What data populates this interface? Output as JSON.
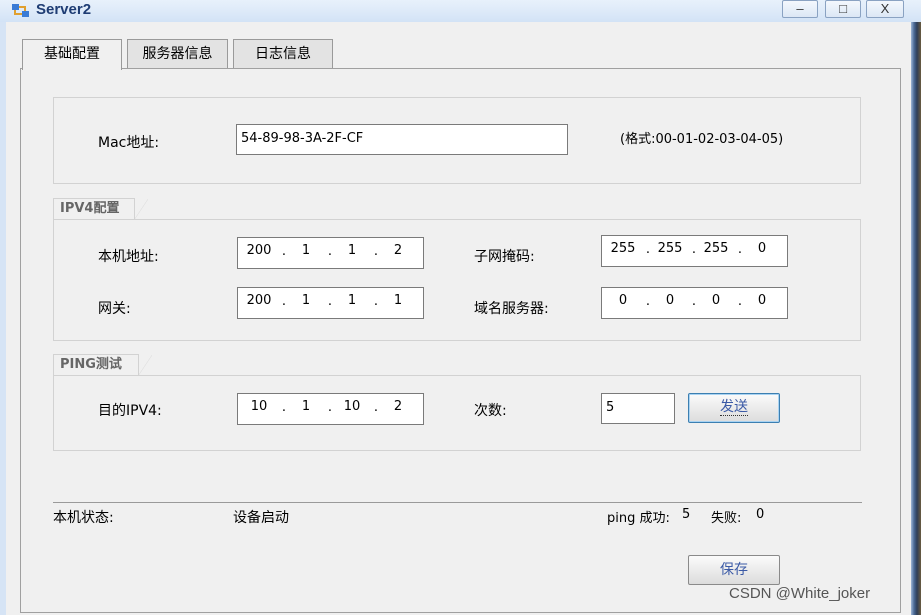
{
  "window": {
    "title": "Server2",
    "minimize": "–",
    "maximize": "□",
    "close": "X"
  },
  "tabs": [
    {
      "label": "基础配置",
      "active": true
    },
    {
      "label": "服务器信息",
      "active": false
    },
    {
      "label": "日志信息",
      "active": false
    }
  ],
  "mac": {
    "label": "Mac地址:",
    "value": "54-89-98-3A-2F-CF",
    "hint": "(格式:00-01-02-03-04-05)"
  },
  "ipv4": {
    "group_title": "IPV4配置",
    "local_ip_label": "本机地址:",
    "local_ip": [
      "200",
      "1",
      "1",
      "2"
    ],
    "subnet_label": "子网掩码:",
    "subnet": [
      "255",
      "255",
      "255",
      "0"
    ],
    "gateway_label": "网关:",
    "gateway": [
      "200",
      "1",
      "1",
      "1"
    ],
    "dns_label": "域名服务器:",
    "dns": [
      "0",
      "0",
      "0",
      "0"
    ]
  },
  "ping": {
    "group_title": "PING测试",
    "dest_label": "目的IPV4:",
    "dest": [
      "10",
      "1",
      "10",
      "2"
    ],
    "count_label": "次数:",
    "count": "5",
    "send_label": "发送"
  },
  "status": {
    "label": "本机状态:",
    "value": "设备启动",
    "ping_success_label": "ping 成功:",
    "ping_success": "5",
    "fail_label": "失败:",
    "fail": "0"
  },
  "save_label": "保存",
  "watermark": "CSDN @White_joker",
  "colors": {
    "title_text": "#1f3d74",
    "button_text": "#3b5aa6",
    "window_background": "#f0f0f0"
  }
}
